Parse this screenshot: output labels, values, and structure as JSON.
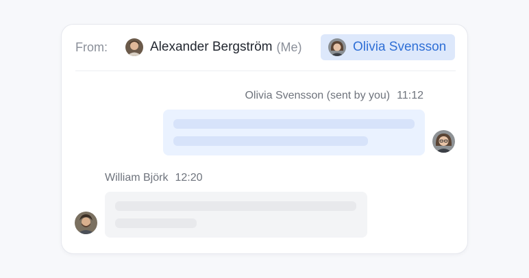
{
  "composer": {
    "from_label": "From:",
    "senders": [
      {
        "name": "Alexander Bergström",
        "suffix": "(Me)",
        "selected": false
      },
      {
        "name": "Olivia Svensson",
        "selected": true
      }
    ]
  },
  "messages": [
    {
      "author": "Olivia Svensson (sent by you)",
      "time": "11:12",
      "side": "right"
    },
    {
      "author": "William Björk",
      "time": "12:20",
      "side": "left"
    }
  ],
  "colors": {
    "accent": "#2f6fd6",
    "selected_bg": "#dde8fb",
    "sent_bubble": "#eaf2ff",
    "received_bubble": "#f3f4f6"
  }
}
